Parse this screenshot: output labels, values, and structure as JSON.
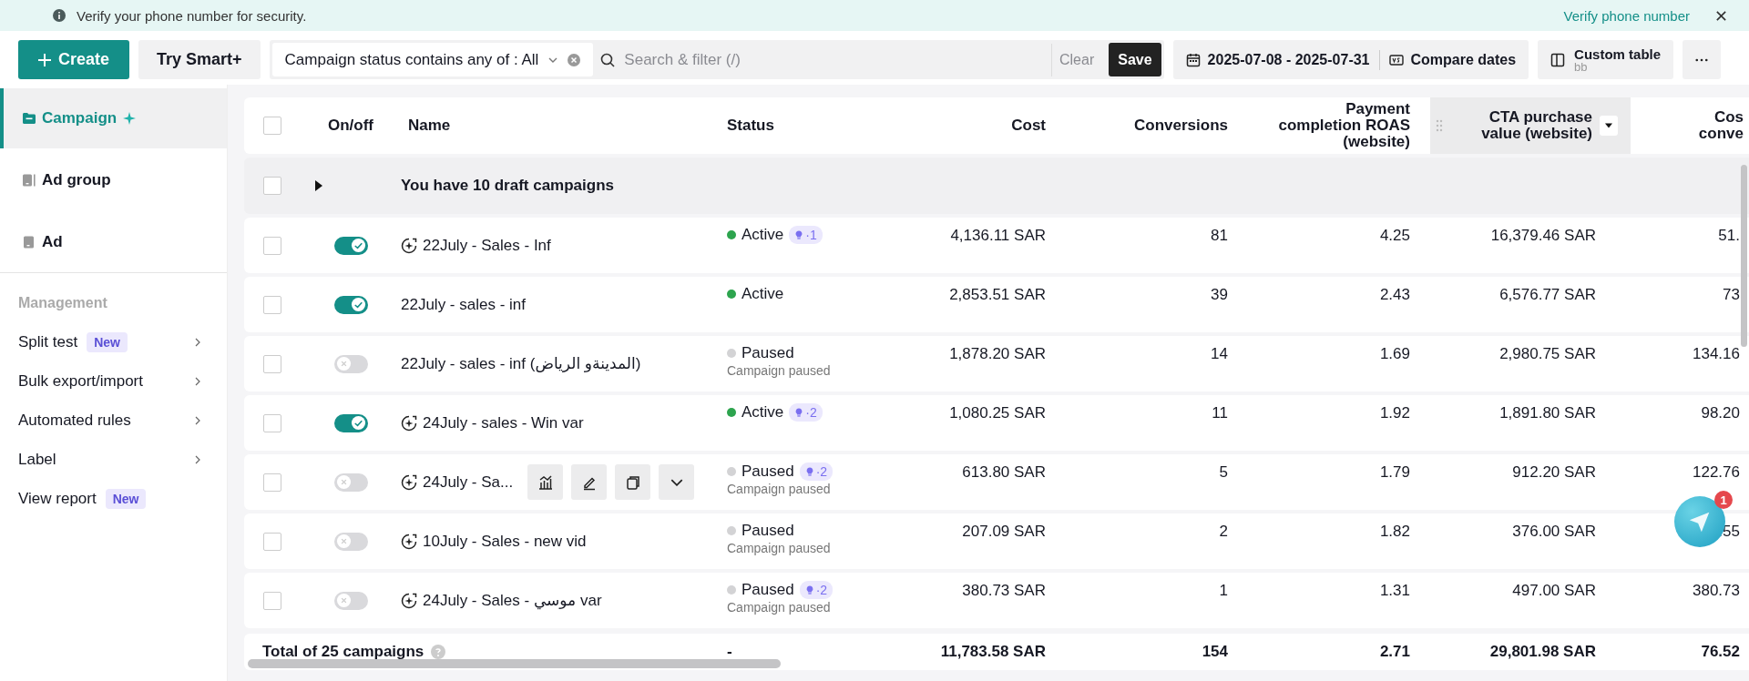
{
  "banner": {
    "message": "Verify your phone number for security.",
    "link": "Verify phone number"
  },
  "toolbar": {
    "create": "Create",
    "smart": "Try Smart+",
    "filter_chip": "Campaign status contains any of : All",
    "search": {
      "placeholder": "Search & filter (/)"
    },
    "clear": "Clear",
    "save": "Save",
    "date_range": "2025-07-08 - 2025-07-31",
    "compare": "Compare dates",
    "custom_table": {
      "label": "Custom table",
      "value": "bb"
    }
  },
  "sidebar": {
    "levels": [
      {
        "label": "Campaign",
        "selected": true
      },
      {
        "label": "Ad group",
        "selected": false
      },
      {
        "label": "Ad",
        "selected": false
      }
    ],
    "section": "Management",
    "items": [
      {
        "label": "Split test",
        "badge": "New",
        "chevron": true
      },
      {
        "label": "Bulk export/import",
        "chevron": true
      },
      {
        "label": "Automated rules",
        "chevron": true
      },
      {
        "label": "Label",
        "chevron": true
      },
      {
        "label": "View report",
        "badge": "New",
        "chevron": false
      }
    ]
  },
  "table": {
    "columns": [
      "On/off",
      "Name",
      "Status",
      "Cost",
      "Conversions",
      "Payment completion ROAS (website)",
      "CTA purchase value (website)",
      "Cos conve"
    ],
    "header_checked": false,
    "draft_checked": false,
    "draft_row": "You have 10 draft campaigns",
    "rows": [
      {
        "checked": false,
        "on": true,
        "smart": true,
        "name": "22July - Sales - Inf",
        "status": "Active",
        "kind": "active",
        "suggestions": "·1",
        "hovered": false,
        "cost": "4,136.11 SAR",
        "conversions": "81",
        "roas": "4.25",
        "cta_value": "16,379.46 SAR",
        "column_8": "51."
      },
      {
        "checked": false,
        "on": true,
        "smart": false,
        "name": "22July - sales - inf",
        "status": "Active",
        "kind": "active",
        "hovered": false,
        "cost": "2,853.51 SAR",
        "conversions": "39",
        "roas": "2.43",
        "cta_value": "6,576.77 SAR",
        "column_8": "73"
      },
      {
        "checked": false,
        "on": false,
        "smart": false,
        "name": "22July - sales - inf (المدينةو الرياض)",
        "status": "Paused",
        "kind": "paused",
        "note": "Campaign paused",
        "hovered": false,
        "cost": "1,878.20 SAR",
        "conversions": "14",
        "roas": "1.69",
        "cta_value": "2,980.75 SAR",
        "column_8": "134.16"
      },
      {
        "checked": false,
        "on": true,
        "smart": true,
        "name": "24July - sales - Win var",
        "status": "Active",
        "kind": "active",
        "suggestions": "·2",
        "hovered": false,
        "cost": "1,080.25 SAR",
        "conversions": "11",
        "roas": "1.92",
        "cta_value": "1,891.80 SAR",
        "column_8": "98.20"
      },
      {
        "checked": false,
        "on": false,
        "smart": true,
        "name": "24July - Sa...",
        "status": "Paused",
        "kind": "paused",
        "note": "Campaign paused",
        "suggestions": "·2",
        "hovered": true,
        "cost": "613.80 SAR",
        "conversions": "5",
        "roas": "1.79",
        "cta_value": "912.20 SAR",
        "column_8": "122.76"
      },
      {
        "checked": false,
        "on": false,
        "smart": true,
        "name": "10July - Sales - new vid",
        "status": "Paused",
        "kind": "paused",
        "note": "Campaign paused",
        "hovered": false,
        "cost": "207.09 SAR",
        "conversions": "2",
        "roas": "1.82",
        "cta_value": "376.00 SAR",
        "column_8": ".55"
      },
      {
        "checked": false,
        "on": false,
        "smart": true,
        "name": "24July - Sales - موسي var",
        "status": "Paused",
        "kind": "paused",
        "note": "Campaign paused",
        "suggestions": "·2",
        "hovered": false,
        "cost": "380.73 SAR",
        "conversions": "1",
        "roas": "1.31",
        "cta_value": "497.00 SAR",
        "column_8": "380.73"
      }
    ],
    "total": {
      "label": "Total of 25 campaigns",
      "status": "-",
      "cost": "11,783.58 SAR",
      "conversions": "154",
      "roas": "2.71",
      "cta_value": "29,801.98 SAR",
      "column_8": "76.52"
    }
  },
  "assistant": {
    "badge": "1"
  }
}
